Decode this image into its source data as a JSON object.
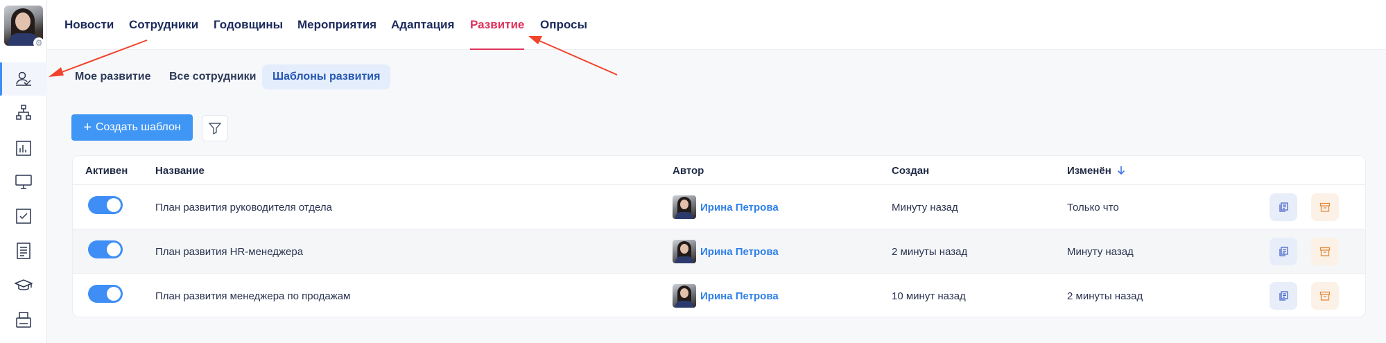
{
  "nav": {
    "tabs": [
      {
        "label": "Новости"
      },
      {
        "label": "Сотрудники"
      },
      {
        "label": "Годовщины"
      },
      {
        "label": "Мероприятия"
      },
      {
        "label": "Адаптация"
      },
      {
        "label": "Развитие",
        "active": true
      },
      {
        "label": "Опросы"
      }
    ]
  },
  "subtabs": [
    {
      "label": "Мое развитие"
    },
    {
      "label": "Все сотрудники"
    },
    {
      "label": "Шаблоны развития",
      "active": true
    }
  ],
  "toolbar": {
    "create_icon": "+",
    "create_label": "Создать шаблон"
  },
  "table": {
    "headers": {
      "active": "Активен",
      "name": "Название",
      "author": "Автор",
      "created": "Создан",
      "modified": "Изменён"
    },
    "rows": [
      {
        "active": true,
        "name": "План развития руководителя отдела",
        "author": "Ирина Петрова",
        "created": "Минуту назад",
        "modified": "Только что"
      },
      {
        "active": true,
        "name": "План развития HR-менеджера",
        "author": "Ирина Петрова",
        "created": "2 минуты назад",
        "modified": "Минуту назад"
      },
      {
        "active": true,
        "name": "План развития менеджера по продажам",
        "author": "Ирина Петрова",
        "created": "10 минут назад",
        "modified": "2 минуты назад"
      }
    ]
  },
  "colors": {
    "accent": "#3f96f5",
    "nav_active": "#e0315b",
    "annotation_arrow": "#f0442c"
  },
  "icons": {
    "rail": [
      "development-icon",
      "org-structure-icon",
      "analytics-icon",
      "monitor-icon",
      "tasks-checkbox-icon",
      "document-icon",
      "education-cap-icon",
      "printer-icon"
    ],
    "row_actions": [
      "copy-icon",
      "archive-icon"
    ]
  }
}
